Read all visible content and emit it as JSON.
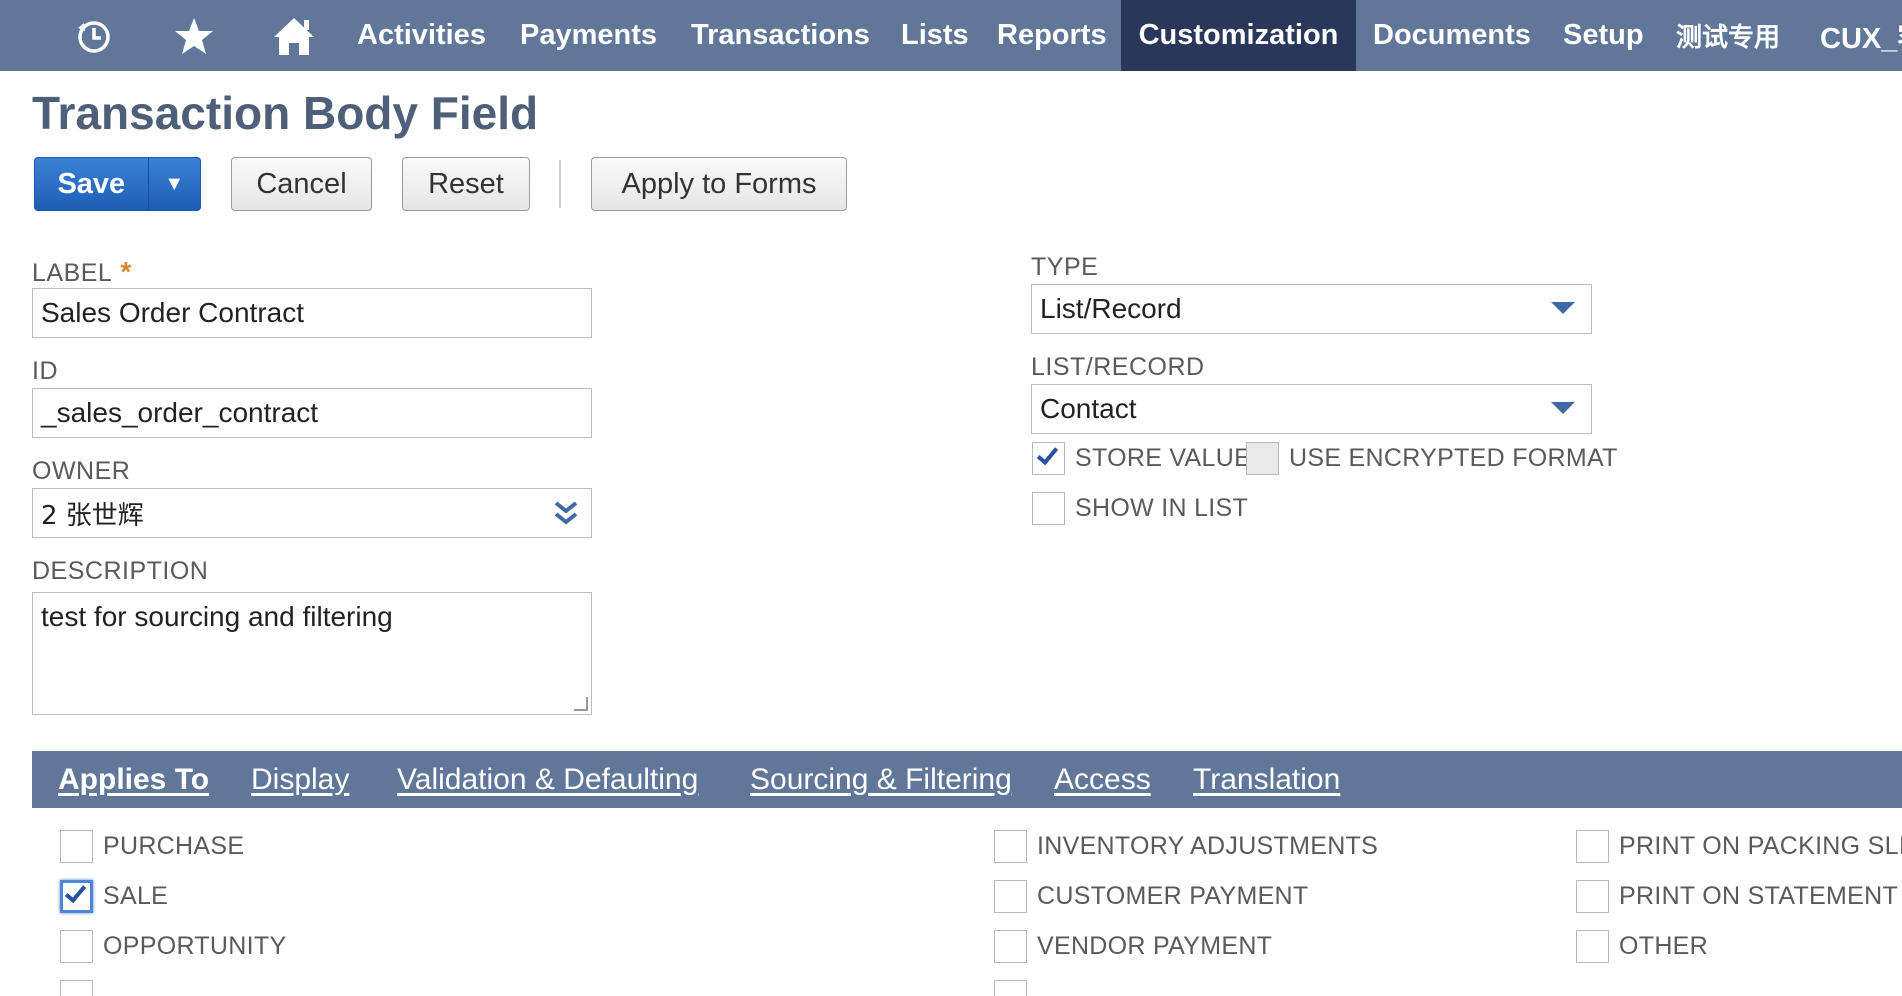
{
  "nav": {
    "icons": [
      "history-icon",
      "star-icon",
      "home-icon"
    ],
    "items": [
      "Activities",
      "Payments",
      "Transactions",
      "Lists",
      "Reports",
      "Customization",
      "Documents",
      "Setup",
      "测试专用",
      "CUX_客"
    ],
    "active": "Customization"
  },
  "page": {
    "title": "Transaction Body Field"
  },
  "toolbar": {
    "save_label": "Save",
    "save_menu_glyph": "▼",
    "cancel_label": "Cancel",
    "reset_label": "Reset",
    "apply_label": "Apply to Forms"
  },
  "form": {
    "label": {
      "caption": "LABEL",
      "required_mark": "*",
      "value": "Sales Order Contract"
    },
    "id": {
      "caption": "ID",
      "value": "_sales_order_contract"
    },
    "owner": {
      "caption": "OWNER",
      "value": "2 张世辉"
    },
    "description": {
      "caption": "DESCRIPTION",
      "value": "test for sourcing and filtering"
    },
    "type": {
      "caption": "TYPE",
      "value": "List/Record"
    },
    "list_record": {
      "caption": "LIST/RECORD",
      "value": "Contact"
    },
    "store_value": {
      "caption": "STORE VALUE",
      "checked": true
    },
    "use_encrypted": {
      "caption": "USE ENCRYPTED FORMAT",
      "checked": false
    },
    "show_in_list": {
      "caption": "SHOW IN LIST",
      "checked": false
    }
  },
  "tabs": [
    {
      "label": "Applies To",
      "active": true
    },
    {
      "label": "Display",
      "active": false
    },
    {
      "label": "Validation & Defaulting",
      "active": false
    },
    {
      "label": "Sourcing & Filtering",
      "active": false
    },
    {
      "label": "Access",
      "active": false
    },
    {
      "label": "Translation",
      "active": false
    }
  ],
  "applies_to": {
    "col1": [
      {
        "label": "PURCHASE",
        "checked": false
      },
      {
        "label": "SALE",
        "checked": true
      },
      {
        "label": "OPPORTUNITY",
        "checked": false
      }
    ],
    "col2": [
      {
        "label": "INVENTORY ADJUSTMENTS",
        "checked": false
      },
      {
        "label": "CUSTOMER PAYMENT",
        "checked": false
      },
      {
        "label": "VENDOR PAYMENT",
        "checked": false
      }
    ],
    "col3": [
      {
        "label": "PRINT ON PACKING SLIP",
        "checked": false
      },
      {
        "label": "PRINT ON STATEMENT",
        "checked": false
      },
      {
        "label": "OTHER",
        "checked": false
      }
    ]
  },
  "colors": {
    "nav_bg": "#607799",
    "nav_active": "#29375a",
    "title": "#4d5f79",
    "primary": "#1d5db5"
  }
}
